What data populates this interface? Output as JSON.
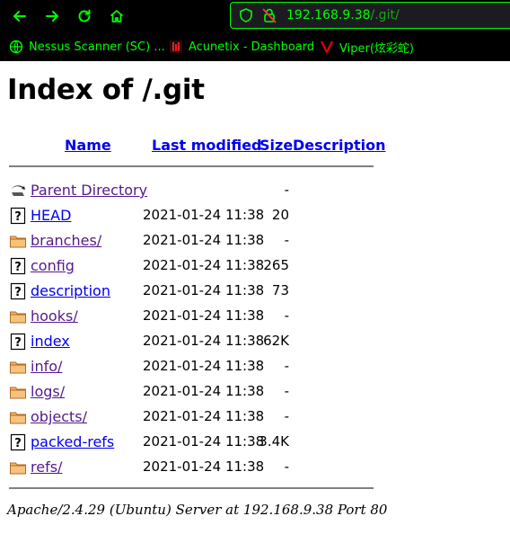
{
  "browser": {
    "url_host": "192.168.9.38",
    "url_path": "/.git/",
    "accent_color": "#00ff00",
    "bookmarks": [
      {
        "label": "Nessus Scanner (SC) ...",
        "icon": "globe-icon"
      },
      {
        "label": "Acunetix - Dashboard",
        "icon": "acunetix-icon"
      },
      {
        "label": "Viper(炫彩蛇)",
        "icon": "viper-icon"
      }
    ]
  },
  "page": {
    "title": "Index of /.git",
    "headers": {
      "name": "Name",
      "last_modified": "Last modified",
      "size": "Size",
      "description": "Description"
    },
    "entries": [
      {
        "icon": "back-icon",
        "name": "Parent Directory",
        "modified": "",
        "size": "-",
        "kind": "dir"
      },
      {
        "icon": "unknown-file-icon",
        "name": "HEAD",
        "modified": "2021-01-24 11:38",
        "size": "20",
        "kind": "file"
      },
      {
        "icon": "folder-icon",
        "name": "branches/",
        "modified": "2021-01-24 11:38",
        "size": "-",
        "kind": "dir"
      },
      {
        "icon": "unknown-file-icon",
        "name": "config",
        "modified": "2021-01-24 11:38",
        "size": "265",
        "kind": "dir"
      },
      {
        "icon": "unknown-file-icon",
        "name": "description",
        "modified": "2021-01-24 11:38",
        "size": "73",
        "kind": "file"
      },
      {
        "icon": "folder-icon",
        "name": "hooks/",
        "modified": "2021-01-24 11:38",
        "size": "-",
        "kind": "dir"
      },
      {
        "icon": "unknown-file-icon",
        "name": "index",
        "modified": "2021-01-24 11:38",
        "size": "62K",
        "kind": "file"
      },
      {
        "icon": "folder-icon",
        "name": "info/",
        "modified": "2021-01-24 11:38",
        "size": "-",
        "kind": "dir"
      },
      {
        "icon": "folder-icon",
        "name": "logs/",
        "modified": "2021-01-24 11:38",
        "size": "-",
        "kind": "dir"
      },
      {
        "icon": "folder-icon",
        "name": "objects/",
        "modified": "2021-01-24 11:38",
        "size": "-",
        "kind": "dir"
      },
      {
        "icon": "unknown-file-icon",
        "name": "packed-refs",
        "modified": "2021-01-24 11:38",
        "size": "3.4K",
        "kind": "file"
      },
      {
        "icon": "folder-icon",
        "name": "refs/",
        "modified": "2021-01-24 11:38",
        "size": "-",
        "kind": "dir"
      }
    ],
    "footer": "Apache/2.4.29 (Ubuntu) Server at 192.168.9.38 Port 80"
  }
}
